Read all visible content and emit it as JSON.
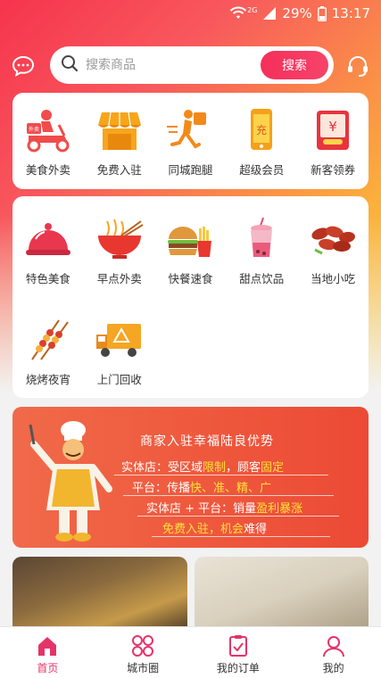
{
  "status_bar": {
    "network": "2G",
    "battery": "29%",
    "time": "13:17"
  },
  "search": {
    "placeholder": "搜索商品",
    "button": "搜索"
  },
  "top_categories": [
    {
      "label": "美食外卖",
      "icon": "delivery-scooter-icon"
    },
    {
      "label": "免费入驻",
      "icon": "shop-awning-icon"
    },
    {
      "label": "同城跑腿",
      "icon": "running-courier-icon"
    },
    {
      "label": "超级会员",
      "icon": "recharge-phone-icon"
    },
    {
      "label": "新客领券",
      "icon": "coupon-envelope-icon"
    }
  ],
  "food_categories": [
    {
      "label": "特色美食",
      "icon": "dish-cover-icon"
    },
    {
      "label": "早点外卖",
      "icon": "noodle-bowl-icon"
    },
    {
      "label": "快餐速食",
      "icon": "burger-fries-icon"
    },
    {
      "label": "甜点饮品",
      "icon": "milk-tea-icon"
    },
    {
      "label": "当地小吃",
      "icon": "sausage-icon"
    },
    {
      "label": "烧烤夜宵",
      "icon": "bbq-skewer-icon"
    },
    {
      "label": "上门回收",
      "icon": "recycle-truck-icon"
    }
  ],
  "banner": {
    "title": "商家入驻幸福陆良优势",
    "line1": {
      "a": "实体店：受区域",
      "b": "限制",
      "c": "，顾客",
      "d": "固定"
    },
    "line2": {
      "a": "平台：传播",
      "b": "快、准、精、广"
    },
    "line3": {
      "a": "实体店 + 平台：销量",
      "b": "盈利暴涨"
    },
    "line4": {
      "a": "免费入驻，机会",
      "b": "难得"
    }
  },
  "bottom_nav": [
    {
      "label": "首页",
      "icon": "home-icon",
      "active": true
    },
    {
      "label": "城市圈",
      "icon": "grid-circles-icon",
      "active": false
    },
    {
      "label": "我的订单",
      "icon": "order-clipboard-icon",
      "active": false
    },
    {
      "label": "我的",
      "icon": "user-icon",
      "active": false
    }
  ],
  "colors": {
    "accent": "#f52f5a",
    "active_nav": "#e5336a",
    "banner": "#ef5b3f",
    "highlight": "#ffe13b"
  }
}
